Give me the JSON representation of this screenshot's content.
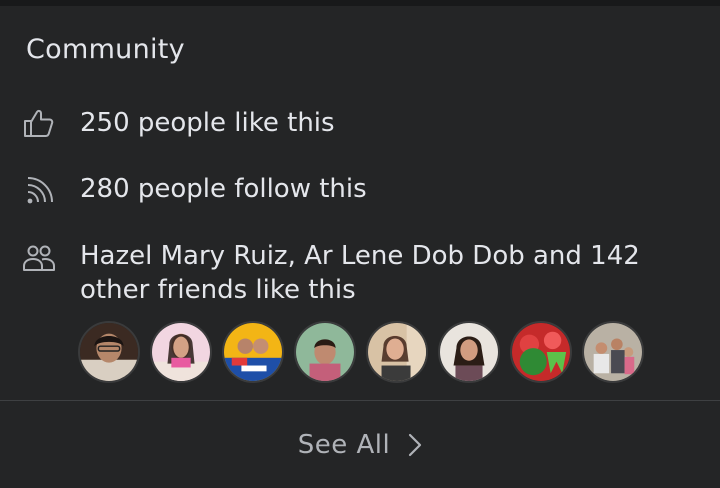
{
  "section": {
    "title": "Community"
  },
  "rows": {
    "likes": {
      "text": "250 people like this",
      "icon": "thumbs-up-icon"
    },
    "follows": {
      "text": "280 people follow this",
      "icon": "rss-feed-icon"
    },
    "friends": {
      "text": "Hazel Mary Ruiz, Ar Lene Dob Dob and 142 other friends like this",
      "icon": "people-icon"
    }
  },
  "friend_avatars": [
    {
      "name": "friend-avatar-1"
    },
    {
      "name": "friend-avatar-2"
    },
    {
      "name": "friend-avatar-3"
    },
    {
      "name": "friend-avatar-4"
    },
    {
      "name": "friend-avatar-5"
    },
    {
      "name": "friend-avatar-6"
    },
    {
      "name": "friend-avatar-7"
    },
    {
      "name": "friend-avatar-8"
    }
  ],
  "footer": {
    "see_all_label": "See All",
    "chevron_icon": "chevron-right-icon"
  },
  "colors": {
    "background": "#242526",
    "text_primary": "#e4e6eb",
    "text_secondary": "#b0b3b8",
    "divider": "#3e4042"
  }
}
